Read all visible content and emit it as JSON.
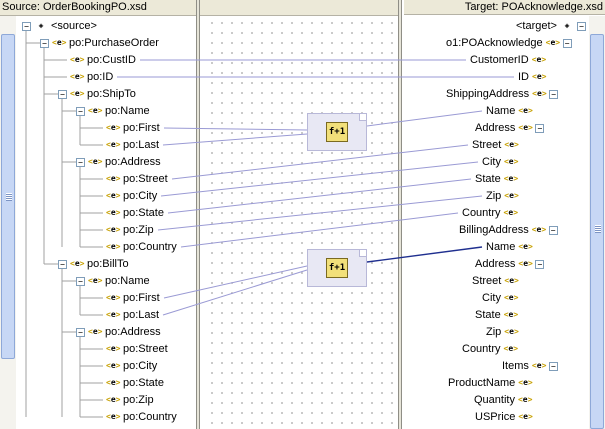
{
  "source_header": "Source: OrderBookingPO.xsd",
  "target_header": "Target: POAcknowledge.xsd",
  "tag_glyph": "<e>",
  "expand_minus": "−",
  "function_label": "f+1",
  "source_tree": [
    {
      "id": "source-root",
      "label": "<source>",
      "kind": "root"
    },
    {
      "id": "purchase-order",
      "label": "po:PurchaseOrder",
      "kind": "node"
    },
    {
      "id": "cust-id",
      "label": "po:CustID",
      "kind": "leaf"
    },
    {
      "id": "id",
      "label": "po:ID",
      "kind": "leaf"
    },
    {
      "id": "ship-to",
      "label": "po:ShipTo",
      "kind": "node"
    },
    {
      "id": "ship-name",
      "label": "po:Name",
      "kind": "node"
    },
    {
      "id": "ship-first",
      "label": "po:First",
      "kind": "leaf"
    },
    {
      "id": "ship-last",
      "label": "po:Last",
      "kind": "leaf"
    },
    {
      "id": "ship-address",
      "label": "po:Address",
      "kind": "node"
    },
    {
      "id": "ship-street",
      "label": "po:Street",
      "kind": "leaf"
    },
    {
      "id": "ship-city",
      "label": "po:City",
      "kind": "leaf"
    },
    {
      "id": "ship-state",
      "label": "po:State",
      "kind": "leaf"
    },
    {
      "id": "ship-zip",
      "label": "po:Zip",
      "kind": "leaf"
    },
    {
      "id": "ship-country",
      "label": "po:Country",
      "kind": "leaf"
    },
    {
      "id": "bill-to",
      "label": "po:BillTo",
      "kind": "node"
    },
    {
      "id": "bill-name",
      "label": "po:Name",
      "kind": "node"
    },
    {
      "id": "bill-first",
      "label": "po:First",
      "kind": "leaf"
    },
    {
      "id": "bill-last",
      "label": "po:Last",
      "kind": "leaf"
    },
    {
      "id": "bill-address",
      "label": "po:Address",
      "kind": "node"
    },
    {
      "id": "bill-street",
      "label": "po:Street",
      "kind": "leaf"
    },
    {
      "id": "bill-city",
      "label": "po:City",
      "kind": "leaf"
    },
    {
      "id": "bill-state",
      "label": "po:State",
      "kind": "leaf"
    },
    {
      "id": "bill-zip",
      "label": "po:Zip",
      "kind": "leaf"
    },
    {
      "id": "bill-country",
      "label": "po:Country",
      "kind": "leaf"
    }
  ],
  "target_tree": [
    {
      "id": "target-root",
      "label": "<target>",
      "kind": "root"
    },
    {
      "id": "po-acknowledge",
      "label": "o1:POAcknowledge",
      "kind": "node"
    },
    {
      "id": "customer-id",
      "label": "CustomerID",
      "kind": "leaf"
    },
    {
      "id": "id",
      "label": "ID",
      "kind": "leaf"
    },
    {
      "id": "shipping-address",
      "label": "ShippingAddress",
      "kind": "node"
    },
    {
      "id": "ship-name",
      "label": "Name",
      "kind": "leaf"
    },
    {
      "id": "ship-address",
      "label": "Address",
      "kind": "node"
    },
    {
      "id": "ship-street",
      "label": "Street",
      "kind": "leaf"
    },
    {
      "id": "ship-city",
      "label": "City",
      "kind": "leaf"
    },
    {
      "id": "ship-state",
      "label": "State",
      "kind": "leaf"
    },
    {
      "id": "ship-zip",
      "label": "Zip",
      "kind": "leaf"
    },
    {
      "id": "ship-country",
      "label": "Country",
      "kind": "leaf"
    },
    {
      "id": "billing-address",
      "label": "BillingAddress",
      "kind": "node"
    },
    {
      "id": "bill-name",
      "label": "Name",
      "kind": "leaf"
    },
    {
      "id": "bill-address",
      "label": "Address",
      "kind": "node"
    },
    {
      "id": "bill-street",
      "label": "Street",
      "kind": "leaf"
    },
    {
      "id": "bill-city",
      "label": "City",
      "kind": "leaf"
    },
    {
      "id": "bill-state",
      "label": "State",
      "kind": "leaf"
    },
    {
      "id": "bill-zip",
      "label": "Zip",
      "kind": "leaf"
    },
    {
      "id": "bill-country",
      "label": "Country",
      "kind": "leaf"
    },
    {
      "id": "items",
      "label": "Items",
      "kind": "node"
    },
    {
      "id": "product-name",
      "label": "ProductName",
      "kind": "leaf"
    },
    {
      "id": "quantity",
      "label": "Quantity",
      "kind": "leaf"
    },
    {
      "id": "us-price",
      "label": "USPrice",
      "kind": "leaf"
    }
  ],
  "colors": {
    "mapping_line": "#9a9ad4",
    "selected_line": "#1f2f8f",
    "tag": "#c7a000",
    "function_box": "#f2e07a"
  }
}
